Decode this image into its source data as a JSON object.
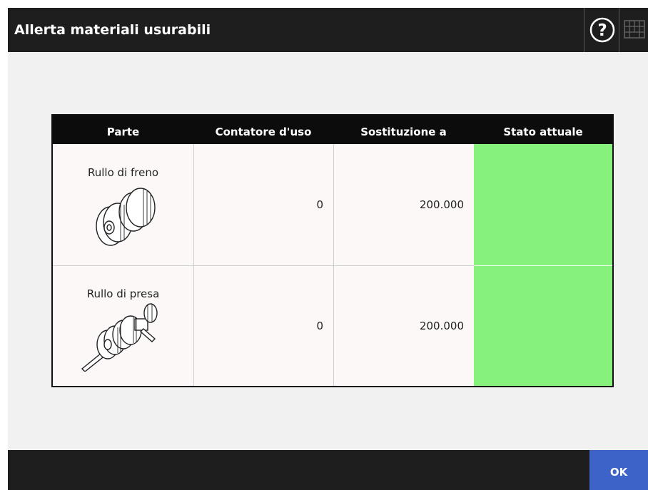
{
  "header": {
    "title": "Allerta materiali usurabili",
    "help_icon": "help-circle-icon",
    "keyboard_icon": "keyboard-icon"
  },
  "table": {
    "columns": [
      "Parte",
      "Contatore d'uso",
      "Sostituzione a",
      "Stato attuale"
    ],
    "rows": [
      {
        "part": "Rullo di freno",
        "icon": "brake-roller-icon",
        "counter": "0",
        "replace_at": "200.000",
        "status_color": "#86f27c"
      },
      {
        "part": "Rullo di presa",
        "icon": "pick-roller-icon",
        "counter": "0",
        "replace_at": "200.000",
        "status_color": "#86f27c"
      }
    ]
  },
  "footer": {
    "ok_label": "OK"
  },
  "colors": {
    "titlebar": "#1e1e1e",
    "ok_button": "#3d63c9",
    "status_ok": "#86f27c"
  }
}
